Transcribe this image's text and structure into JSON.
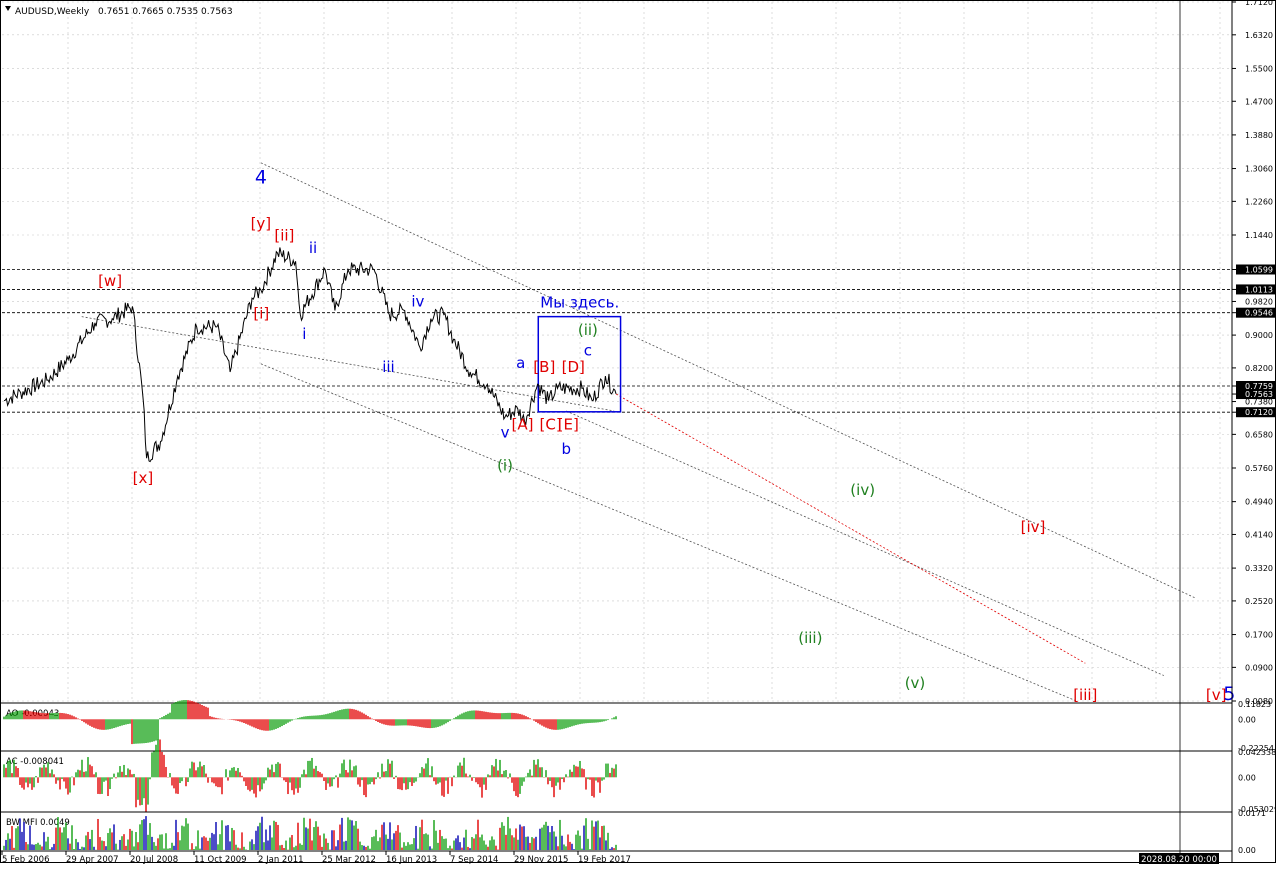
{
  "header": {
    "symbol": "AUDUSD,Weekly",
    "ohlc": "0.7651 0.7665 0.7535 0.7563"
  },
  "colors": {
    "price": "#000000",
    "grid": "#c8c8c8",
    "wave_red": "#e00000",
    "wave_blue": "#0000e0",
    "wave_green": "#208020",
    "channel": "#505050",
    "target_line": "#e00000",
    "box": "#0000e0",
    "ao_up": "#10a010",
    "ao_down": "#e00000",
    "date_box_bg": "#000000"
  },
  "chart_data": {
    "type": "line",
    "title": "AUDUSD,Weekly",
    "price_axis": {
      "ticks": [
        "1.7120",
        "1.6320",
        "1.5500",
        "1.4700",
        "1.3880",
        "1.3060",
        "1.2260",
        "1.1440",
        "1.0599",
        "1.0113",
        "0.9820",
        "0.9546",
        "0.9000",
        "0.8200",
        "0.7759",
        "0.7563",
        "0.7380",
        "0.7120",
        "0.6580",
        "0.5760",
        "0.4940",
        "0.4140",
        "0.3320",
        "0.2520",
        "0.1700",
        "0.0900",
        "0.0080"
      ],
      "tick_values": [
        1.712,
        1.632,
        1.55,
        1.47,
        1.388,
        1.306,
        1.226,
        1.144,
        1.0599,
        1.0113,
        0.982,
        0.9546,
        0.9,
        0.82,
        0.7759,
        0.7563,
        0.738,
        0.712,
        0.658,
        0.576,
        0.494,
        0.414,
        0.332,
        0.252,
        0.17,
        0.09,
        0.008
      ],
      "boxed": [
        "1.0599",
        "1.0113",
        "0.9546",
        "0.7759",
        "0.7563",
        "0.7120"
      ],
      "ylim": [
        0.008,
        1.712
      ]
    },
    "time_axis": {
      "labels": [
        "5 Feb 2006",
        "29 Apr 2007",
        "20 Jul 2008",
        "11 Oct 2009",
        "2 Jan 2011",
        "25 Mar 2012",
        "16 Jun 2013",
        "7 Sep 2014",
        "29 Nov 2015",
        "19 Feb 2017"
      ],
      "cursor_label": "2028.08.20 00:00"
    },
    "price_series": {
      "name": "AUDUSD",
      "points": [
        [
          "2006-02-05",
          0.74
        ],
        [
          "2006-06-01",
          0.76
        ],
        [
          "2006-12-01",
          0.79
        ],
        [
          "2007-04-29",
          0.84
        ],
        [
          "2007-11-01",
          0.93
        ],
        [
          "2008-03-01",
          0.94
        ],
        [
          "2008-07-20",
          0.97
        ],
        [
          "2008-10-01",
          0.75
        ],
        [
          "2008-10-27",
          0.6
        ],
        [
          "2009-02-01",
          0.64
        ],
        [
          "2009-06-01",
          0.8
        ],
        [
          "2009-10-11",
          0.92
        ],
        [
          "2010-03-01",
          0.92
        ],
        [
          "2010-06-01",
          0.81
        ],
        [
          "2010-11-01",
          0.99
        ],
        [
          "2011-01-02",
          1.01
        ],
        [
          "2011-04-28",
          1.1
        ],
        [
          "2011-09-01",
          1.08
        ],
        [
          "2011-10-04",
          0.95
        ],
        [
          "2012-03-25",
          1.06
        ],
        [
          "2012-06-01",
          0.96
        ],
        [
          "2012-09-01",
          1.06
        ],
        [
          "2013-03-01",
          1.06
        ],
        [
          "2013-06-16",
          0.95
        ],
        [
          "2013-10-01",
          0.96
        ],
        [
          "2014-01-15",
          0.87
        ],
        [
          "2014-04-01",
          0.94
        ],
        [
          "2014-07-01",
          0.95
        ],
        [
          "2014-09-07",
          0.89
        ],
        [
          "2015-01-01",
          0.81
        ],
        [
          "2015-05-01",
          0.78
        ],
        [
          "2015-09-01",
          0.7
        ],
        [
          "2015-11-29",
          0.72
        ],
        [
          "2016-01-15",
          0.69
        ],
        [
          "2016-04-15",
          0.78
        ],
        [
          "2016-07-01",
          0.74
        ],
        [
          "2016-09-01",
          0.77
        ],
        [
          "2017-02-19",
          0.77
        ],
        [
          "2017-05-01",
          0.74
        ],
        [
          "2017-08-01",
          0.8
        ],
        [
          "2017-10-15",
          0.7563
        ]
      ]
    },
    "levels": [
      1.0599,
      1.0113,
      0.9546,
      0.7759,
      0.712
    ],
    "channel_lines": [
      {
        "from": [
          "2011-01-02",
          1.32
        ],
        "to": [
          "2028-11-01",
          0.26
        ]
      },
      {
        "from": [
          "2011-01-02",
          0.83
        ],
        "to": [
          "2026-08-01",
          0.008
        ]
      },
      {
        "from": [
          "2016-11-01",
          0.715
        ],
        "to": [
          "2028-04-01",
          0.07
        ]
      },
      {
        "from": [
          "2007-08-01",
          0.945
        ],
        "to": [
          "2017-10-01",
          0.715
        ]
      }
    ],
    "target_line": {
      "from": [
        "2017-10-15",
        0.7563
      ],
      "to": [
        "2026-10-01",
        0.1
      ]
    },
    "focus_box": {
      "from": [
        "2016-04-20",
        0.945
      ],
      "to": [
        "2017-11-15",
        0.713
      ]
    },
    "annotation_text": "Мы здесь.",
    "wave_labels": [
      {
        "text": "4",
        "date": "2011-01-02",
        "price": 1.27,
        "color": "blue",
        "size": "large"
      },
      {
        "text": "[y]",
        "date": "2011-01-02",
        "price": 1.16,
        "color": "red"
      },
      {
        "text": "[ii]",
        "date": "2011-06-15",
        "price": 1.13,
        "color": "red"
      },
      {
        "text": "ii",
        "date": "2012-01-01",
        "price": 1.1,
        "color": "blue"
      },
      {
        "text": "[w]",
        "date": "2008-02-15",
        "price": 1.02,
        "color": "red"
      },
      {
        "text": "[i]",
        "date": "2011-01-05",
        "price": 0.94,
        "color": "red"
      },
      {
        "text": "i",
        "date": "2011-11-01",
        "price": 0.89,
        "color": "blue"
      },
      {
        "text": "iv",
        "date": "2014-01-01",
        "price": 0.97,
        "color": "blue"
      },
      {
        "text": "iii",
        "date": "2013-06-10",
        "price": 0.81,
        "color": "blue"
      },
      {
        "text": "a",
        "date": "2015-12-20",
        "price": 0.82,
        "color": "blue"
      },
      {
        "text": "[B]",
        "date": "2016-06-01",
        "price": 0.81,
        "color": "red"
      },
      {
        "text": "[D]",
        "date": "2016-12-20",
        "price": 0.81,
        "color": "red"
      },
      {
        "text": "c",
        "date": "2017-04-01",
        "price": 0.85,
        "color": "blue"
      },
      {
        "text": "(ii)",
        "date": "2017-04-01",
        "price": 0.9,
        "color": "green"
      },
      {
        "text": "v",
        "date": "2015-09-01",
        "price": 0.65,
        "color": "blue"
      },
      {
        "text": "[A]",
        "date": "2016-01-01",
        "price": 0.67,
        "color": "red"
      },
      {
        "text": "[C]",
        "date": "2016-07-15",
        "price": 0.67,
        "color": "red"
      },
      {
        "text": "[E]",
        "date": "2016-11-15",
        "price": 0.67,
        "color": "red"
      },
      {
        "text": "b",
        "date": "2016-11-01",
        "price": 0.61,
        "color": "blue"
      },
      {
        "text": "(i)",
        "date": "2015-09-01",
        "price": 0.57,
        "color": "green"
      },
      {
        "text": "[x]",
        "date": "2008-10-01",
        "price": 0.54,
        "color": "red"
      },
      {
        "text": "(iv)",
        "date": "2022-07-01",
        "price": 0.51,
        "color": "green"
      },
      {
        "text": "[iv]",
        "date": "2025-10-01",
        "price": 0.42,
        "color": "red"
      },
      {
        "text": "(iii)",
        "date": "2021-07-01",
        "price": 0.15,
        "color": "green"
      },
      {
        "text": "(v)",
        "date": "2023-07-01",
        "price": 0.04,
        "color": "green"
      },
      {
        "text": "[iii]",
        "date": "2026-10-01",
        "price": 0.01,
        "color": "red"
      },
      {
        "text": "[v]",
        "date": "2029-04-01",
        "price": 0.01,
        "color": "red"
      },
      {
        "text": "5",
        "date": "2029-07-01",
        "price": 0.01,
        "color": "blue",
        "size": "large"
      }
    ],
    "indicators": [
      {
        "name": "AO",
        "label": "AO -0.00043",
        "ticks": [
          "0.11823",
          "0.00",
          "-0.22254"
        ],
        "tick_values": [
          0.11823,
          0,
          -0.22254
        ]
      },
      {
        "name": "AC",
        "label": "AC -0.008041",
        "ticks": [
          "0.042338",
          "0.00",
          "-0.053029"
        ],
        "tick_values": [
          0.042338,
          0,
          -0.053029
        ]
      },
      {
        "name": "BW MFI",
        "label": "BW MFI 0.0049",
        "ticks": [
          "0.0171",
          "0.00"
        ],
        "tick_values": [
          0.0171,
          0
        ]
      }
    ]
  }
}
